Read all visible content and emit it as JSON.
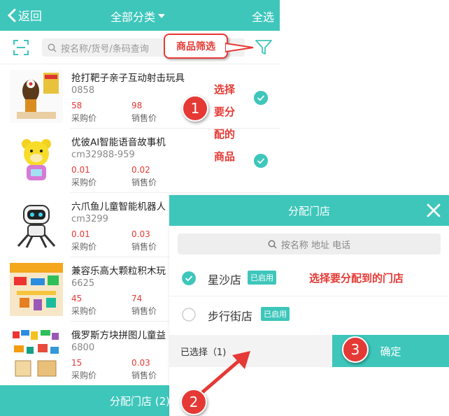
{
  "header": {
    "back_label": "返回",
    "title": "全部分类",
    "select_all_label": "全选"
  },
  "search": {
    "placeholder": "按名称/货号/条码查询"
  },
  "filter_callout": "商品筛选",
  "products": [
    {
      "name": "抢打靶子亲子互动射击玩具",
      "code": "0858",
      "purchase_price": "58",
      "sale_price": "98",
      "purchase_label": "采购价",
      "sale_label": "销售价",
      "selected": true
    },
    {
      "name": "优彼AI智能语音故事机",
      "code": "cm32988-959",
      "purchase_price": "0.01",
      "sale_price": "0.02",
      "purchase_label": "采购价",
      "sale_label": "销售价",
      "selected": true
    },
    {
      "name": "六爪鱼儿童智能机器人",
      "code": "cm3299",
      "purchase_price": "0.01",
      "sale_price": "0.03",
      "purchase_label": "采购价",
      "sale_label": "销售价",
      "selected": false
    },
    {
      "name": "兼容乐高大颗粒积木玩",
      "code": "6625",
      "purchase_price": "45",
      "sale_price": "74",
      "purchase_label": "采购价",
      "sale_label": "销售价",
      "selected": false
    },
    {
      "name": "俄罗斯方块拼图儿童益",
      "code": "6800",
      "purchase_price": "15",
      "sale_price": "0.03",
      "purchase_label": "采购价",
      "sale_label": "销售价",
      "selected": false
    }
  ],
  "annotation_select": "选择要分配的商品",
  "step_labels": [
    "1",
    "2",
    "3"
  ],
  "bottom_button": "分配门店 (2)",
  "modal": {
    "title": "分配门店",
    "search_placeholder": "按名称 地址 电话",
    "stores": [
      {
        "name": "星沙店",
        "status": "已启用",
        "checked": true
      },
      {
        "name": "步行街店",
        "status": "已启用",
        "checked": false
      }
    ],
    "annotation": "选择要分配到的门店",
    "selected_label": "已选择（1)",
    "confirm_label": "确定"
  },
  "colors": {
    "accent": "#3ec6bb",
    "annotation_red": "#e53935"
  }
}
